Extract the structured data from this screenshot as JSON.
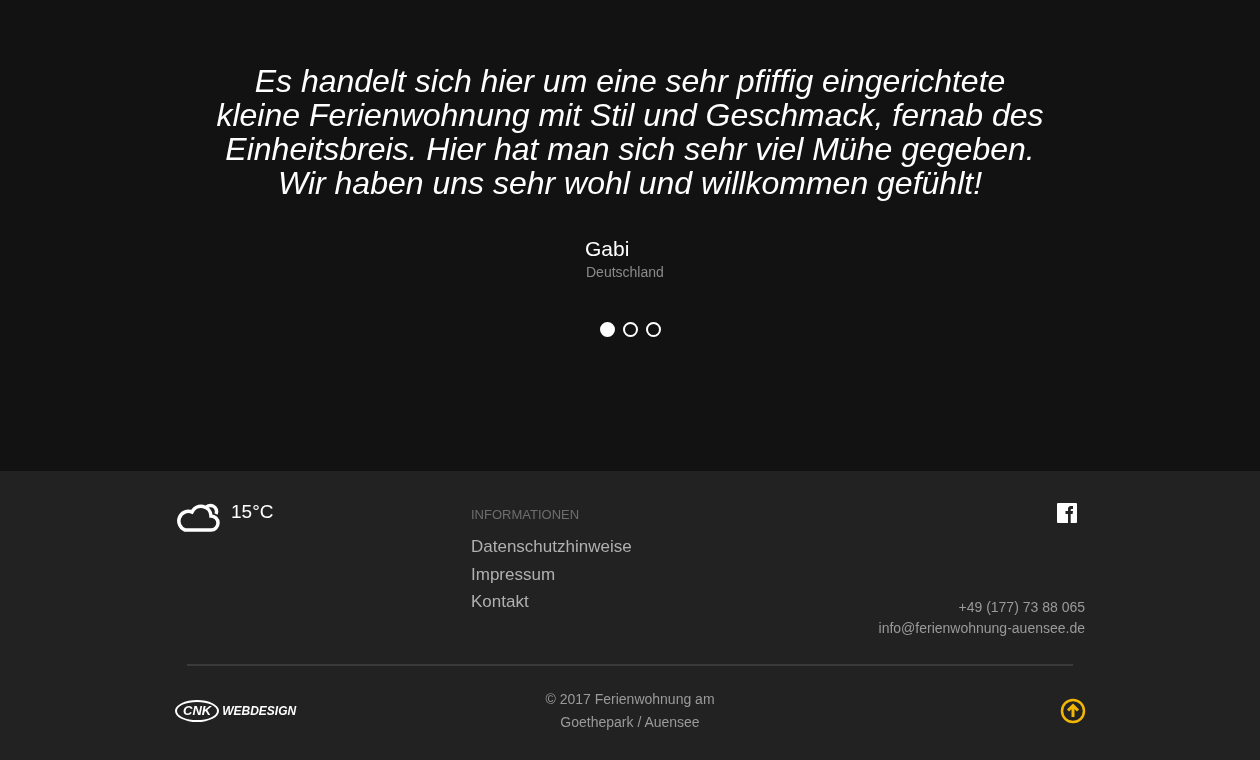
{
  "testimonial": {
    "quote": "Es handelt sich hier um eine sehr pfiffig eingerichtete kleine Ferienwohnung mit Stil und Geschmack, fernab des Einheitsbreis. Hier hat man sich sehr viel Mühe gegeben. Wir haben uns sehr wohl und willkommen gefühlt!",
    "author": "Gabi",
    "origin": "Deutschland",
    "dots": [
      {
        "selected": true
      },
      {
        "selected": false
      },
      {
        "selected": false
      }
    ]
  },
  "footer": {
    "weather": {
      "temperature": "15°C"
    },
    "info": {
      "heading": "INFORMATIONEN",
      "links": [
        "Datenschutzhinweise",
        "Impressum",
        "Kontakt"
      ]
    },
    "contact": {
      "phone": "+49 (177) 73 88 065",
      "email": "info@ferienwohnung-auensee.de"
    },
    "logo": {
      "mark": "CNK",
      "text": "WEBDESIGN"
    },
    "copyright": "© 2017 Ferienwohnung am Goethepark / Auensee"
  }
}
